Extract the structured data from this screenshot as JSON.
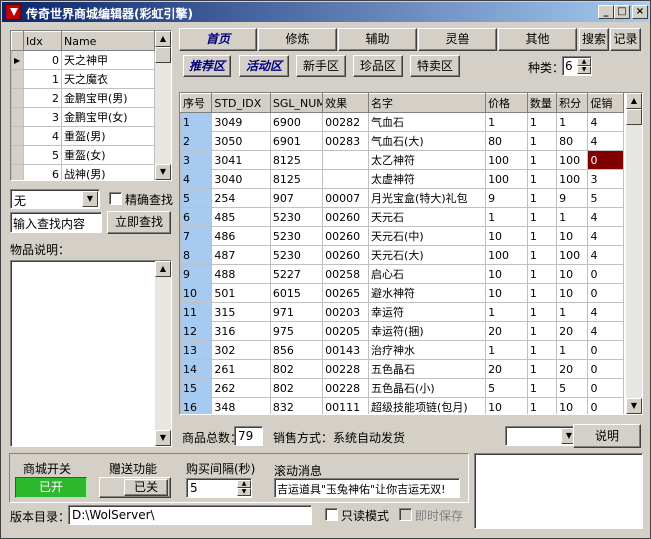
{
  "window": {
    "title": "传奇世界商城编辑器(彩虹引擎)",
    "btn_min": "_",
    "btn_max": "□",
    "btn_close": "×"
  },
  "left_list": {
    "headers": [
      "Idx",
      "Name"
    ],
    "rows": [
      {
        "idx": "0",
        "name": "天之神甲"
      },
      {
        "idx": "1",
        "name": "天之魔衣"
      },
      {
        "idx": "2",
        "name": "金鹏宝甲(男)"
      },
      {
        "idx": "3",
        "name": "金鹏宝甲(女)"
      },
      {
        "idx": "4",
        "name": "重盔(男)"
      },
      {
        "idx": "5",
        "name": "重盔(女)"
      },
      {
        "idx": "6",
        "name": "战神(男)"
      }
    ]
  },
  "search": {
    "combo_value": "无",
    "exact_label": "精确查找",
    "input_value": "输入查找内容",
    "search_button": "立即查找"
  },
  "desc_label": "物品说明：",
  "top_tabs": [
    "首页",
    "修炼",
    "辅助",
    "灵兽",
    "其他"
  ],
  "search_btn": "搜索",
  "record_btn": "记录",
  "sub_tabs": [
    "推荐区",
    "活动区",
    "新手区",
    "珍品区",
    "特卖区"
  ],
  "category": {
    "label": "种类：",
    "value": "6"
  },
  "table": {
    "headers": [
      "序号",
      "STD_IDX",
      "SGL_NUM",
      "效果",
      "名字",
      "价格",
      "数量",
      "积分",
      "促销"
    ],
    "rows": [
      [
        "1",
        "3049",
        "6900",
        "00282",
        "气血石",
        "1",
        "1",
        "1",
        "4"
      ],
      [
        "2",
        "3050",
        "6901",
        "00283",
        "气血石(大)",
        "80",
        "1",
        "80",
        "4"
      ],
      [
        "3",
        "3041",
        "8125",
        "",
        "太乙神符",
        "100",
        "1",
        "100",
        "0"
      ],
      [
        "4",
        "3040",
        "8125",
        "",
        "太虚神符",
        "100",
        "1",
        "100",
        "3"
      ],
      [
        "5",
        "254",
        "907",
        "00007",
        "月光宝盒(特大)礼包",
        "9",
        "1",
        "9",
        "5"
      ],
      [
        "6",
        "485",
        "5230",
        "00260",
        "天元石",
        "1",
        "1",
        "1",
        "4"
      ],
      [
        "7",
        "486",
        "5230",
        "00260",
        "天元石(中)",
        "10",
        "1",
        "10",
        "4"
      ],
      [
        "8",
        "487",
        "5230",
        "00260",
        "天元石(大)",
        "100",
        "1",
        "100",
        "4"
      ],
      [
        "9",
        "488",
        "5227",
        "00258",
        "启心石",
        "10",
        "1",
        "10",
        "0"
      ],
      [
        "10",
        "501",
        "6015",
        "00265",
        "避水神符",
        "10",
        "1",
        "10",
        "0"
      ],
      [
        "11",
        "315",
        "971",
        "00203",
        "幸运符",
        "1",
        "1",
        "1",
        "4"
      ],
      [
        "12",
        "316",
        "975",
        "00205",
        "幸运符(捆)",
        "20",
        "1",
        "20",
        "4"
      ],
      [
        "13",
        "302",
        "856",
        "00143",
        "治疗神水",
        "1",
        "1",
        "1",
        "0"
      ],
      [
        "14",
        "261",
        "802",
        "00228",
        "五色晶石",
        "20",
        "1",
        "20",
        "0"
      ],
      [
        "15",
        "262",
        "802",
        "00228",
        "五色晶石(小)",
        "5",
        "1",
        "5",
        "0"
      ],
      [
        "16",
        "348",
        "832",
        "00111",
        "超级技能项链(包月)",
        "10",
        "1",
        "10",
        "0"
      ]
    ]
  },
  "footer": {
    "total_label": "商品总数：",
    "total_value": "79",
    "sale_mode": "销售方式：系统自动发货",
    "combo_value": "",
    "explain_button": "说明"
  },
  "bottom": {
    "mall_switch_label": "商城开关",
    "mall_switch_value": "已开",
    "gift_label": "赠送功能",
    "gift_value": "已关",
    "interval_label": "购买间隔(秒)",
    "interval_value": "5",
    "scroll_label": "滚动消息",
    "scroll_value": "吉运道具\"玉兔神佑\"让你吉运无双!",
    "dir_label": "版本目录：",
    "dir_value": "D:\\WolServer\\",
    "readonly_label": "只读模式",
    "save_label": "即时保存"
  },
  "colors": {
    "title_start": "#0a246a",
    "title_end": "#a6caf0",
    "row_header": "#a6caf0",
    "switch_on": "#2eb82e",
    "selected_cell": "#800000"
  }
}
